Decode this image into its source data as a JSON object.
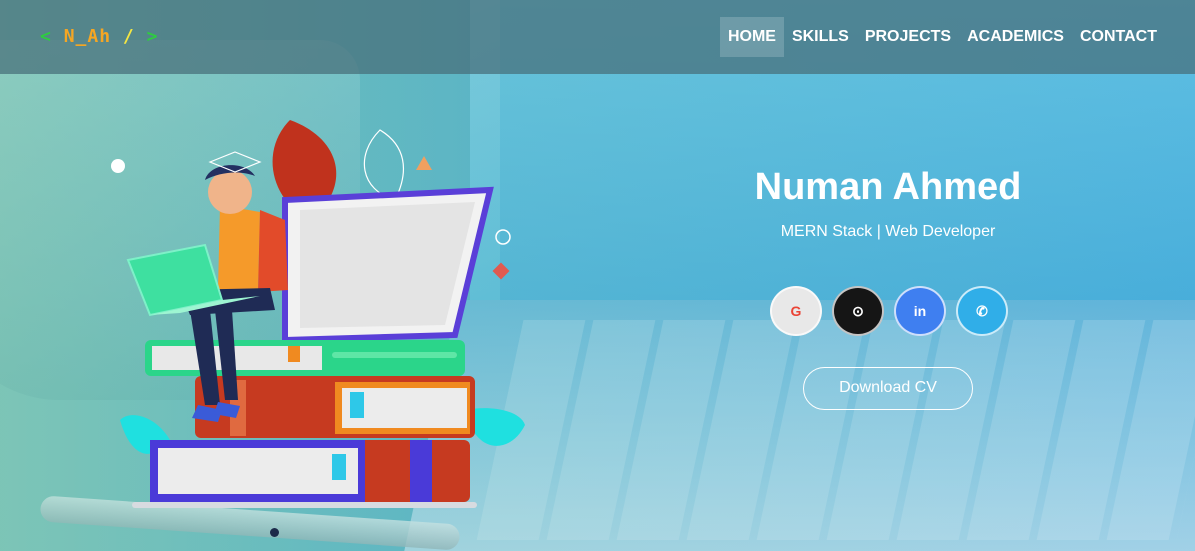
{
  "logo": {
    "open": "<",
    "name": "N_Ah",
    "slash": "/",
    "close": ">"
  },
  "nav": {
    "items": [
      {
        "label": "HOME",
        "active": true
      },
      {
        "label": "SKILLS",
        "active": false
      },
      {
        "label": "PROJECTS",
        "active": false
      },
      {
        "label": "ACADEMICS",
        "active": false
      },
      {
        "label": "CONTACT",
        "active": false
      }
    ]
  },
  "hero": {
    "name": "Numan Ahmed",
    "subtitle": "MERN Stack | Web Developer",
    "cv_button": "Download CV"
  },
  "socials": [
    {
      "icon": "google-icon",
      "glyph": "G"
    },
    {
      "icon": "github-icon",
      "glyph": "⊙"
    },
    {
      "icon": "linkedin-icon",
      "glyph": "in"
    },
    {
      "icon": "phone-icon",
      "glyph": "✆"
    }
  ],
  "colors": {
    "navbar": "#466e78",
    "logo_green": "#2ecc40",
    "logo_orange": "#f5a623",
    "google": "#ea4335",
    "github": "#151515",
    "linkedin": "#3f7ff0",
    "phone": "#30aee8"
  }
}
